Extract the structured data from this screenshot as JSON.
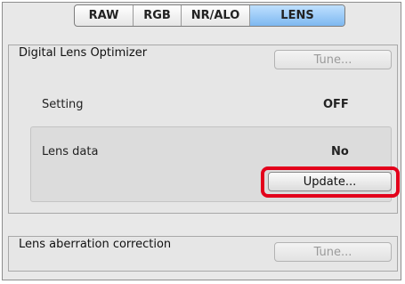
{
  "tabs": [
    {
      "label": "RAW",
      "active": false
    },
    {
      "label": "RGB",
      "active": false
    },
    {
      "label": "NR/ALO",
      "active": false
    },
    {
      "label": "LENS",
      "active": true
    }
  ],
  "digital_lens_optimizer": {
    "title": "Digital Lens Optimizer",
    "tune_label": "Tune...",
    "setting_label": "Setting",
    "setting_value": "OFF",
    "lens_data_label": "Lens data",
    "lens_data_value": "No",
    "update_label": "Update..."
  },
  "lens_aberration_correction": {
    "title": "Lens aberration correction",
    "tune_label": "Tune..."
  },
  "colors": {
    "active_tab": "#7db8f0",
    "highlight": "#e3001b"
  }
}
